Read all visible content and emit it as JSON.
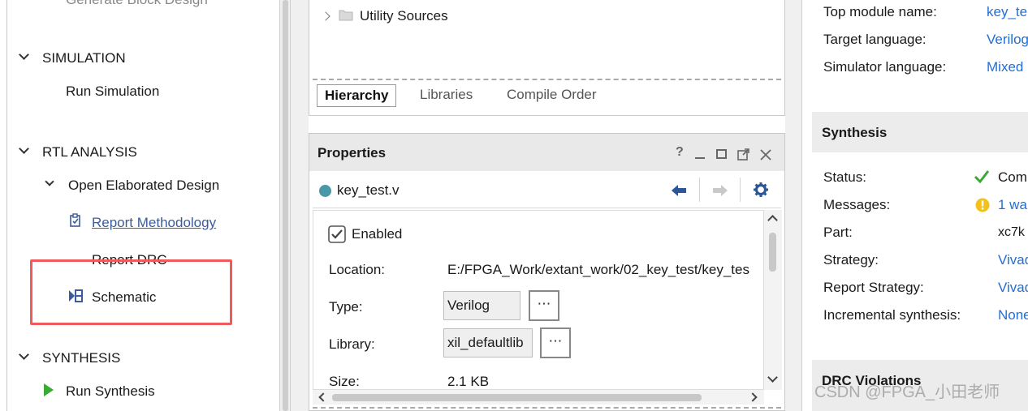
{
  "flow_navigator": {
    "generate_block_design": "Generate Block Design",
    "simulation": {
      "title": "SIMULATION",
      "run_simulation": "Run Simulation"
    },
    "rtl_analysis": {
      "title": "RTL ANALYSIS",
      "open_elaborated_design": "Open Elaborated Design",
      "report_methodology": "Report Methodology",
      "report_drc": "Report DRC",
      "schematic": "Schematic"
    },
    "synthesis": {
      "title": "SYNTHESIS",
      "run_synthesis": "Run Synthesis"
    }
  },
  "sources": {
    "utility_sources": "Utility Sources",
    "tabs": [
      "Hierarchy",
      "Libraries",
      "Compile Order"
    ],
    "active_tab": "Hierarchy"
  },
  "properties": {
    "title": "Properties",
    "help_icon": "?",
    "file_name": "key_test.v",
    "enabled_label": "Enabled",
    "enabled_checked": true,
    "location_label": "Location:",
    "location_value": "E:/FPGA_Work/extant_work/02_key_test/key_tes",
    "type_label": "Type:",
    "type_value": "Verilog",
    "library_label": "Library:",
    "library_value": "xil_defaultlib",
    "size_label": "Size:",
    "size_value": "2.1 KB",
    "more_button": "⋯"
  },
  "summary": {
    "project": {
      "top_module_label": "Top module name:",
      "top_module_value": "key_te",
      "target_language_label": "Target language:",
      "target_language_value": "Verilog",
      "simulator_language_label": "Simulator language:",
      "simulator_language_value": "Mixed"
    },
    "synthesis": {
      "title": "Synthesis",
      "status_label": "Status:",
      "status_value": "Com",
      "messages_label": "Messages:",
      "messages_value": "1 wa",
      "part_label": "Part:",
      "part_value": "xc7k",
      "strategy_label": "Strategy:",
      "strategy_value": "Vivad",
      "report_strategy_label": "Report Strategy:",
      "report_strategy_value": "Vivad",
      "incremental_label": "Incremental synthesis:",
      "incremental_value": "None"
    },
    "drc": {
      "title": "DRC Violations"
    }
  },
  "watermark": "CSDN @FPGA_小田老师",
  "colors": {
    "highlight": "#f05a5a",
    "link": "#1f6fd8",
    "run_green": "#3aaa35",
    "warning_yellow": "#f2c21b",
    "file_dot": "#4a97a8"
  }
}
